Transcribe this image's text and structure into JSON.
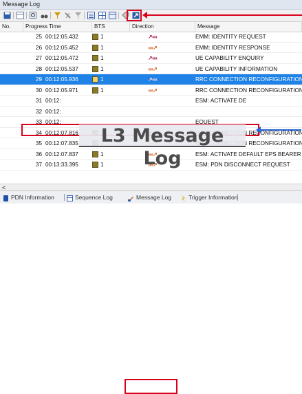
{
  "window": {
    "title": "Message Log"
  },
  "toolbar": {
    "icons": [
      "save-icon",
      "table-icon",
      "search-icon",
      "binoculars-icon",
      "filter-icon",
      "pin-icon",
      "filter-off-icon",
      "list-icon",
      "grid-icon",
      "grid2-icon",
      "tag-icon",
      "export-icon"
    ]
  },
  "columns": {
    "no": "No.",
    "time": "Progress Time",
    "bts": "BTS",
    "dir": "Direction",
    "msg": "Message"
  },
  "rows": [
    {
      "no": "25",
      "time": "00:12:05.432",
      "bts": "1",
      "dir": "dl",
      "msg": "EMM: IDENTITY REQUEST"
    },
    {
      "no": "26",
      "time": "00:12:05.452",
      "bts": "1",
      "dir": "ul",
      "msg": "EMM: IDENTITY RESPONSE"
    },
    {
      "no": "27",
      "time": "00:12:05.472",
      "bts": "1",
      "dir": "dl",
      "msg": "UE CAPABILITY ENQUIRY"
    },
    {
      "no": "28",
      "time": "00:12:05.537",
      "bts": "1",
      "dir": "ul",
      "msg": "UE CAPABILITY INFORMATION"
    },
    {
      "no": "29",
      "time": "00:12:05.936",
      "bts": "1",
      "dir": "dl",
      "msg": "RRC CONNECTION RECONFIGURATION"
    },
    {
      "no": "30",
      "time": "00:12:05.971",
      "bts": "1",
      "dir": "ul",
      "msg": "RRC CONNECTION RECONFIGURATION COMPL"
    },
    {
      "no": "31",
      "time": "00:12:",
      "bts": "",
      "dir": "",
      "msg": "ESM: ACTIVATE DE"
    },
    {
      "no": "32",
      "time": "00:12:",
      "bts": "",
      "dir": "",
      "msg": ""
    },
    {
      "no": "33",
      "time": "00:12:",
      "bts": "",
      "dir": "",
      "msg": "EQUEST"
    },
    {
      "no": "34",
      "time": "00:12:07.816",
      "bts": "1",
      "dir": "dl",
      "msg": "RRC CONNECTION RECONFIGURATION"
    },
    {
      "no": "35",
      "time": "00:12:07.835",
      "bts": "1",
      "dir": "ul",
      "msg": "RRC CONNECTION RECONFIGURATION COMPL"
    },
    {
      "no": "36",
      "time": "00:12:07.837",
      "bts": "1",
      "dir": "ul",
      "msg": "ESM: ACTIVATE DEFAULT EPS BEARER CONTE"
    },
    {
      "no": "37",
      "time": "00:13:33.395",
      "bts": "1",
      "dir": "ul",
      "msg": "ESM: PDN DISCONNECT REQUEST"
    }
  ],
  "selected_row": "29",
  "overlay": {
    "title": "L3 Message Log"
  },
  "tabs": [
    {
      "label": "PDN Information",
      "icon": "pdn-icon"
    },
    {
      "label": "Sequence Log",
      "icon": "sequence-icon"
    },
    {
      "label": "Message Log",
      "icon": "message-icon"
    },
    {
      "label": "Trigger Information",
      "icon": "trigger-icon"
    }
  ],
  "colors": {
    "selection": "#1e82e6",
    "annotation_red": "#d9001b",
    "annotation_blue": "#2466d6"
  }
}
